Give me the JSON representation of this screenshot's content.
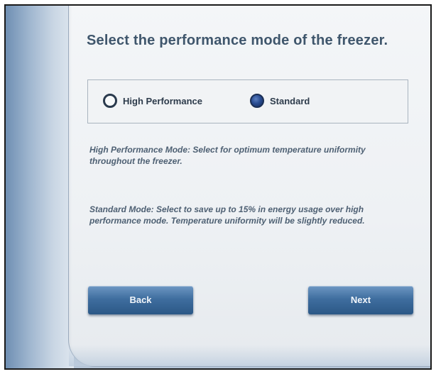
{
  "title": "Select the performance mode of the freezer.",
  "modes": {
    "high_performance": {
      "label": "High Performance",
      "selected": false
    },
    "standard": {
      "label": "Standard",
      "selected": true
    }
  },
  "descriptions": {
    "high_performance": "High Performance Mode: Select for optimum temperature uniformity throughout the freezer.",
    "standard": "Standard Mode: Select to save up to 15% in energy usage over high performance mode. Temperature uniformity will be slightly reduced."
  },
  "buttons": {
    "back": "Back",
    "next": "Next"
  },
  "colors": {
    "title": "#3f566c",
    "button": "#3f6e9f",
    "radio_selected": "#2a4d93"
  }
}
